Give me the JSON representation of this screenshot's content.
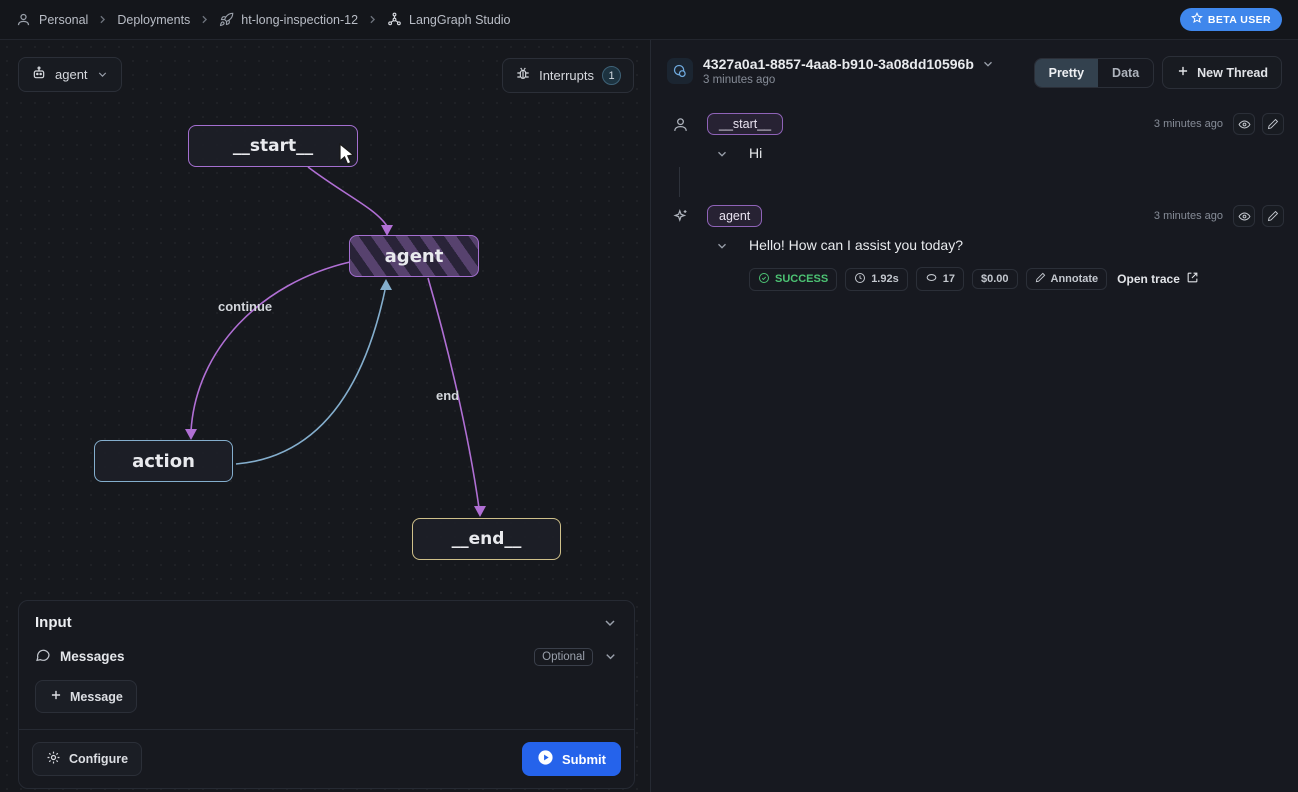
{
  "breadcrumb": {
    "items": [
      {
        "icon": "person-icon",
        "label": "Personal"
      },
      {
        "icon": "",
        "label": "Deployments"
      },
      {
        "icon": "rocket-icon",
        "label": "ht-long-inspection-12"
      },
      {
        "icon": "graph-icon",
        "label": "LangGraph Studio"
      }
    ],
    "beta_badge": "BETA USER"
  },
  "graph": {
    "selector": {
      "label": "agent",
      "icon": "robot-icon"
    },
    "interrupts": {
      "label": "Interrupts",
      "count": "1",
      "icon": "bug-icon"
    },
    "nodes": [
      {
        "id": "__start__",
        "label": "__start__",
        "border_color": "#a46fd0"
      },
      {
        "id": "agent",
        "label": "agent",
        "border_color": "#a46fd0",
        "striped": true
      },
      {
        "id": "action",
        "label": "action",
        "border_color": "#84aecd"
      },
      {
        "id": "__end__",
        "label": "__end__",
        "border_color": "#cfc08a"
      }
    ],
    "edges": [
      {
        "from": "__start__",
        "to": "agent",
        "label": "",
        "color": "#b06fd4"
      },
      {
        "from": "agent",
        "to": "action",
        "label": "continue",
        "color": "#b06fd4"
      },
      {
        "from": "action",
        "to": "agent",
        "label": "",
        "color": "#84aecd"
      },
      {
        "from": "agent",
        "to": "__end__",
        "label": "end",
        "color": "#b06fd4"
      }
    ]
  },
  "input_panel": {
    "title": "Input",
    "messages_label": "Messages",
    "optional_badge": "Optional",
    "add_message_label": "Message",
    "configure_label": "Configure",
    "submit_label": "Submit"
  },
  "thread": {
    "id": "4327a0a1-8857-4aa8-b910-3a08dd10596b",
    "timestamp": "3 minutes ago",
    "tabs": [
      {
        "label": "Pretty",
        "active": true
      },
      {
        "label": "Data",
        "active": false
      }
    ],
    "new_thread_label": "New Thread",
    "messages": [
      {
        "role": "user",
        "badge": "__start__",
        "text": "Hi",
        "timestamp": "3 minutes ago"
      },
      {
        "role": "assistant",
        "badge": "agent",
        "text": "Hello! How can I assist you today?",
        "timestamp": "3 minutes ago",
        "meta": {
          "status": "SUCCESS",
          "duration": "1.92s",
          "tokens": "17",
          "cost": "$0.00",
          "annotate_label": "Annotate",
          "open_trace_label": "Open trace"
        }
      }
    ]
  },
  "colors": {
    "accent_purple": "#b06fd4",
    "node_blue": "#84aecd",
    "node_yellow": "#cfc08a",
    "submit_blue": "#2563eb",
    "beta_blue": "#3f87ec",
    "success_green": "#4cc273"
  }
}
